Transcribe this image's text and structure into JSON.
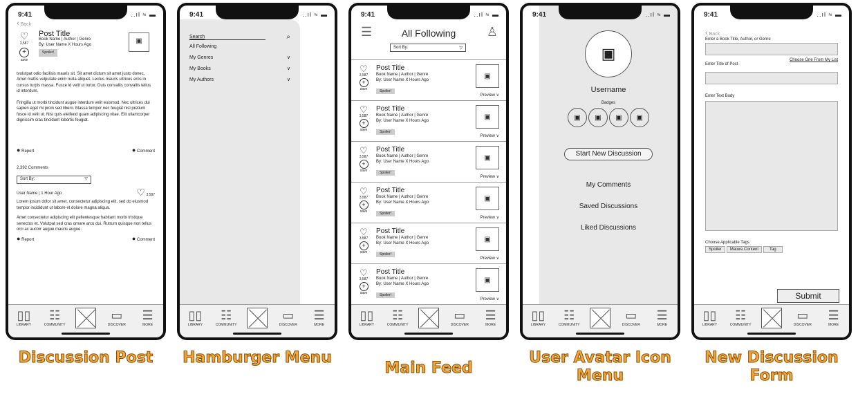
{
  "status": {
    "time": "9:41",
    "icons": "..ıl ≈ ▬"
  },
  "tabbar": {
    "library": "LIBRARY",
    "community": "COMMUNITY",
    "discover": "DISCOVER",
    "more": "MORE"
  },
  "captions": {
    "discussion_post": "Discussion Post",
    "hamburger": "Hamburger Menu",
    "feed": "Main Feed",
    "avatar": "User Avatar Icon Menu",
    "form": "New Discussion Form"
  },
  "post": {
    "back": "Back",
    "title": "Post Title",
    "meta1": "Book Name | Author | Genre",
    "meta2": "By: User Name X Hours Ago",
    "spoiler": "Spoiler!",
    "likes": "3,587",
    "save": "save",
    "body1": "tvolutpat odio facilisis mauris sit. Sit amet dictum sit amet justo donec. Amet mattis vulputate enim nulla aliquet. Lectus mauris ultrices eros in cursus turpis massa. Fusce id velit ut tortor. Duis convallis convallis tellus id interdum.",
    "body2": "Fringilla ut morbi tincidunt augue interdum velit euismod. Nec ultrices dui sapien eget mi proin sed libero. Massa tempor nec feugiat nisl pretium fusce id velit ut. Nisi quis eleifend quam adipiscing vitae. Elit ullamcorper dignissim cras tincidunt lobortis feugiat.",
    "report": "Report",
    "comment": "Comment",
    "comments_count": "2,392 Comments",
    "sort_by": "Sort By:",
    "c_user": "User Name | 1 Hour Ago",
    "c_likes": "3,587",
    "c_body1": "Lorem ipsum dolor sit amet, consectetur adipiscing elit, sed do eiusmod tempor incididunt ut labore et dolore magna aliqua.",
    "c_body2": "Amet consectetur adipiscing elit pellentesque habitant morbi tristique senectus et. Volutpat sed cras ornare arcu dui. Rutrum quisque non tellus orci ac auctor augue mauris augue."
  },
  "hamburger": {
    "search": "Search",
    "items": [
      "All Following",
      "My Genres",
      "My Books",
      "My Authors"
    ]
  },
  "feed": {
    "title": "All Following",
    "sort_by": "Sort By:",
    "preview": "Preview",
    "posts": [
      {
        "title": "Post Title",
        "meta1": "Book Name | Author | Genre",
        "meta2": "By: User Name X Hours Ago",
        "spoiler": "Spoiler!",
        "likes": "3,587",
        "save": "save"
      },
      {
        "title": "Post Title",
        "meta1": "Book Name | Author | Genre",
        "meta2": "By: User Name X Hours Ago",
        "spoiler": "Spoiler!",
        "likes": "3,587",
        "save": "save"
      },
      {
        "title": "Post Title",
        "meta1": "Book Name | Author | Genre",
        "meta2": "By: User Name X Hours Ago",
        "spoiler": "Spoiler!",
        "likes": "3,587",
        "save": "save"
      },
      {
        "title": "Post Title",
        "meta1": "Book Name | Author | Genre",
        "meta2": "By: User Name X Hours Ago",
        "spoiler": "Spoiler!",
        "likes": "3,587",
        "save": "save"
      },
      {
        "title": "Post Title",
        "meta1": "Book Name | Author | Genre",
        "meta2": "By: User Name X Hours Ago",
        "spoiler": "Spoiler!",
        "likes": "3,587",
        "save": "save"
      },
      {
        "title": "Post Title",
        "meta1": "Book Name | Author | Genre",
        "meta2": "By: User Name X Hours Ago",
        "spoiler": "Spoiler!",
        "likes": "3,587",
        "save": "save"
      }
    ]
  },
  "avatar": {
    "username": "Username",
    "badges": "Badges",
    "start": "Start New Discussion",
    "my_comments": "My Comments",
    "saved": "Saved Discussions",
    "liked": "Liked Discussions"
  },
  "form": {
    "back": "Back",
    "label_book": "Enter a Book Title, Author, or Genre",
    "choose_list": "Choose One From My List",
    "label_title": "Enter Title of Post",
    "label_body": "Enter Text Body",
    "label_tags": "Choose Applicable Tags",
    "tags": [
      "Spoiler",
      "Mature Content",
      "Tag"
    ],
    "submit": "Submit"
  }
}
